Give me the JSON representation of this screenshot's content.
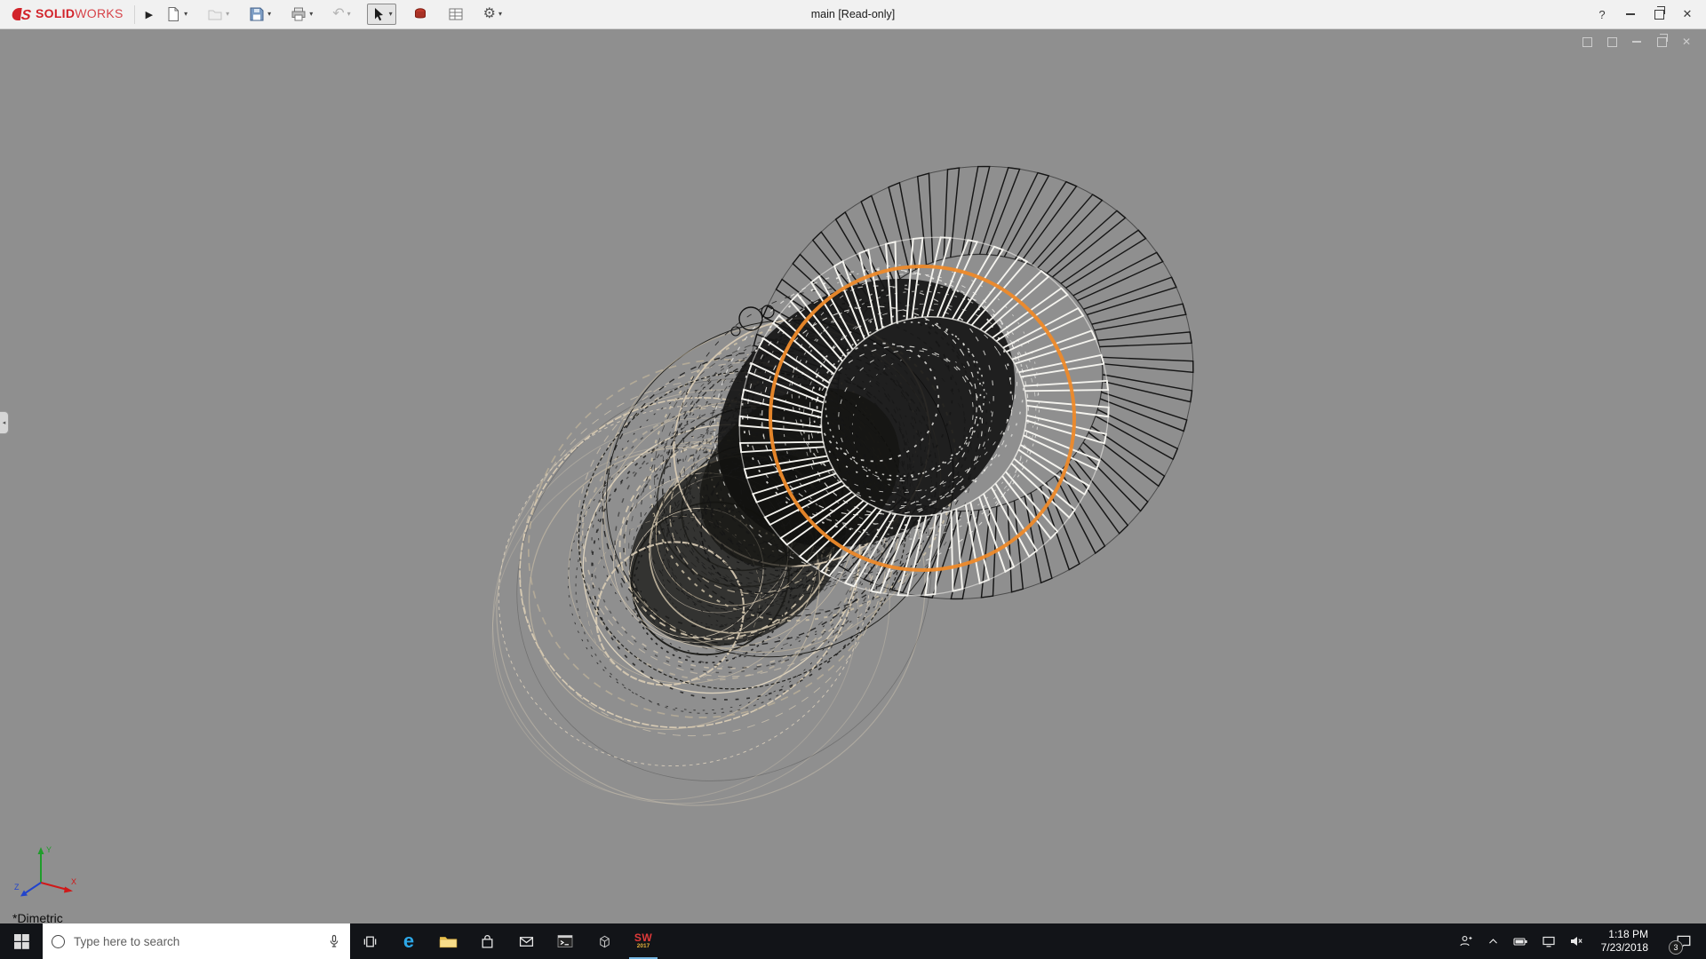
{
  "icons": {
    "flyout": "▶",
    "caret": "▾",
    "help": "?",
    "close": "✕",
    "undo": "↶",
    "gear": "⚙",
    "edge": "e",
    "collapse_tab": "◂"
  },
  "titlebar": {
    "brand": {
      "solid": "SOLID",
      "works": "WORKS"
    },
    "title": "main [Read-only]"
  },
  "toolbar": {
    "icons": [
      "new-document",
      "open",
      "save",
      "print",
      "undo",
      "select-tool",
      "appearance",
      "design-table",
      "options"
    ]
  },
  "viewport": {
    "background": "#8F8F8F",
    "highlight_color": "#EE8A2A",
    "view_label": "*Dimetric",
    "triad": {
      "x": "X",
      "y": "Y",
      "z": "Z"
    }
  },
  "taskbar": {
    "search": {
      "placeholder": "Type here to search"
    },
    "solidworks": {
      "label": "SW",
      "year": "2017"
    },
    "tray": {
      "time": "1:18 PM",
      "date": "7/23/2018",
      "badge": "3"
    }
  }
}
